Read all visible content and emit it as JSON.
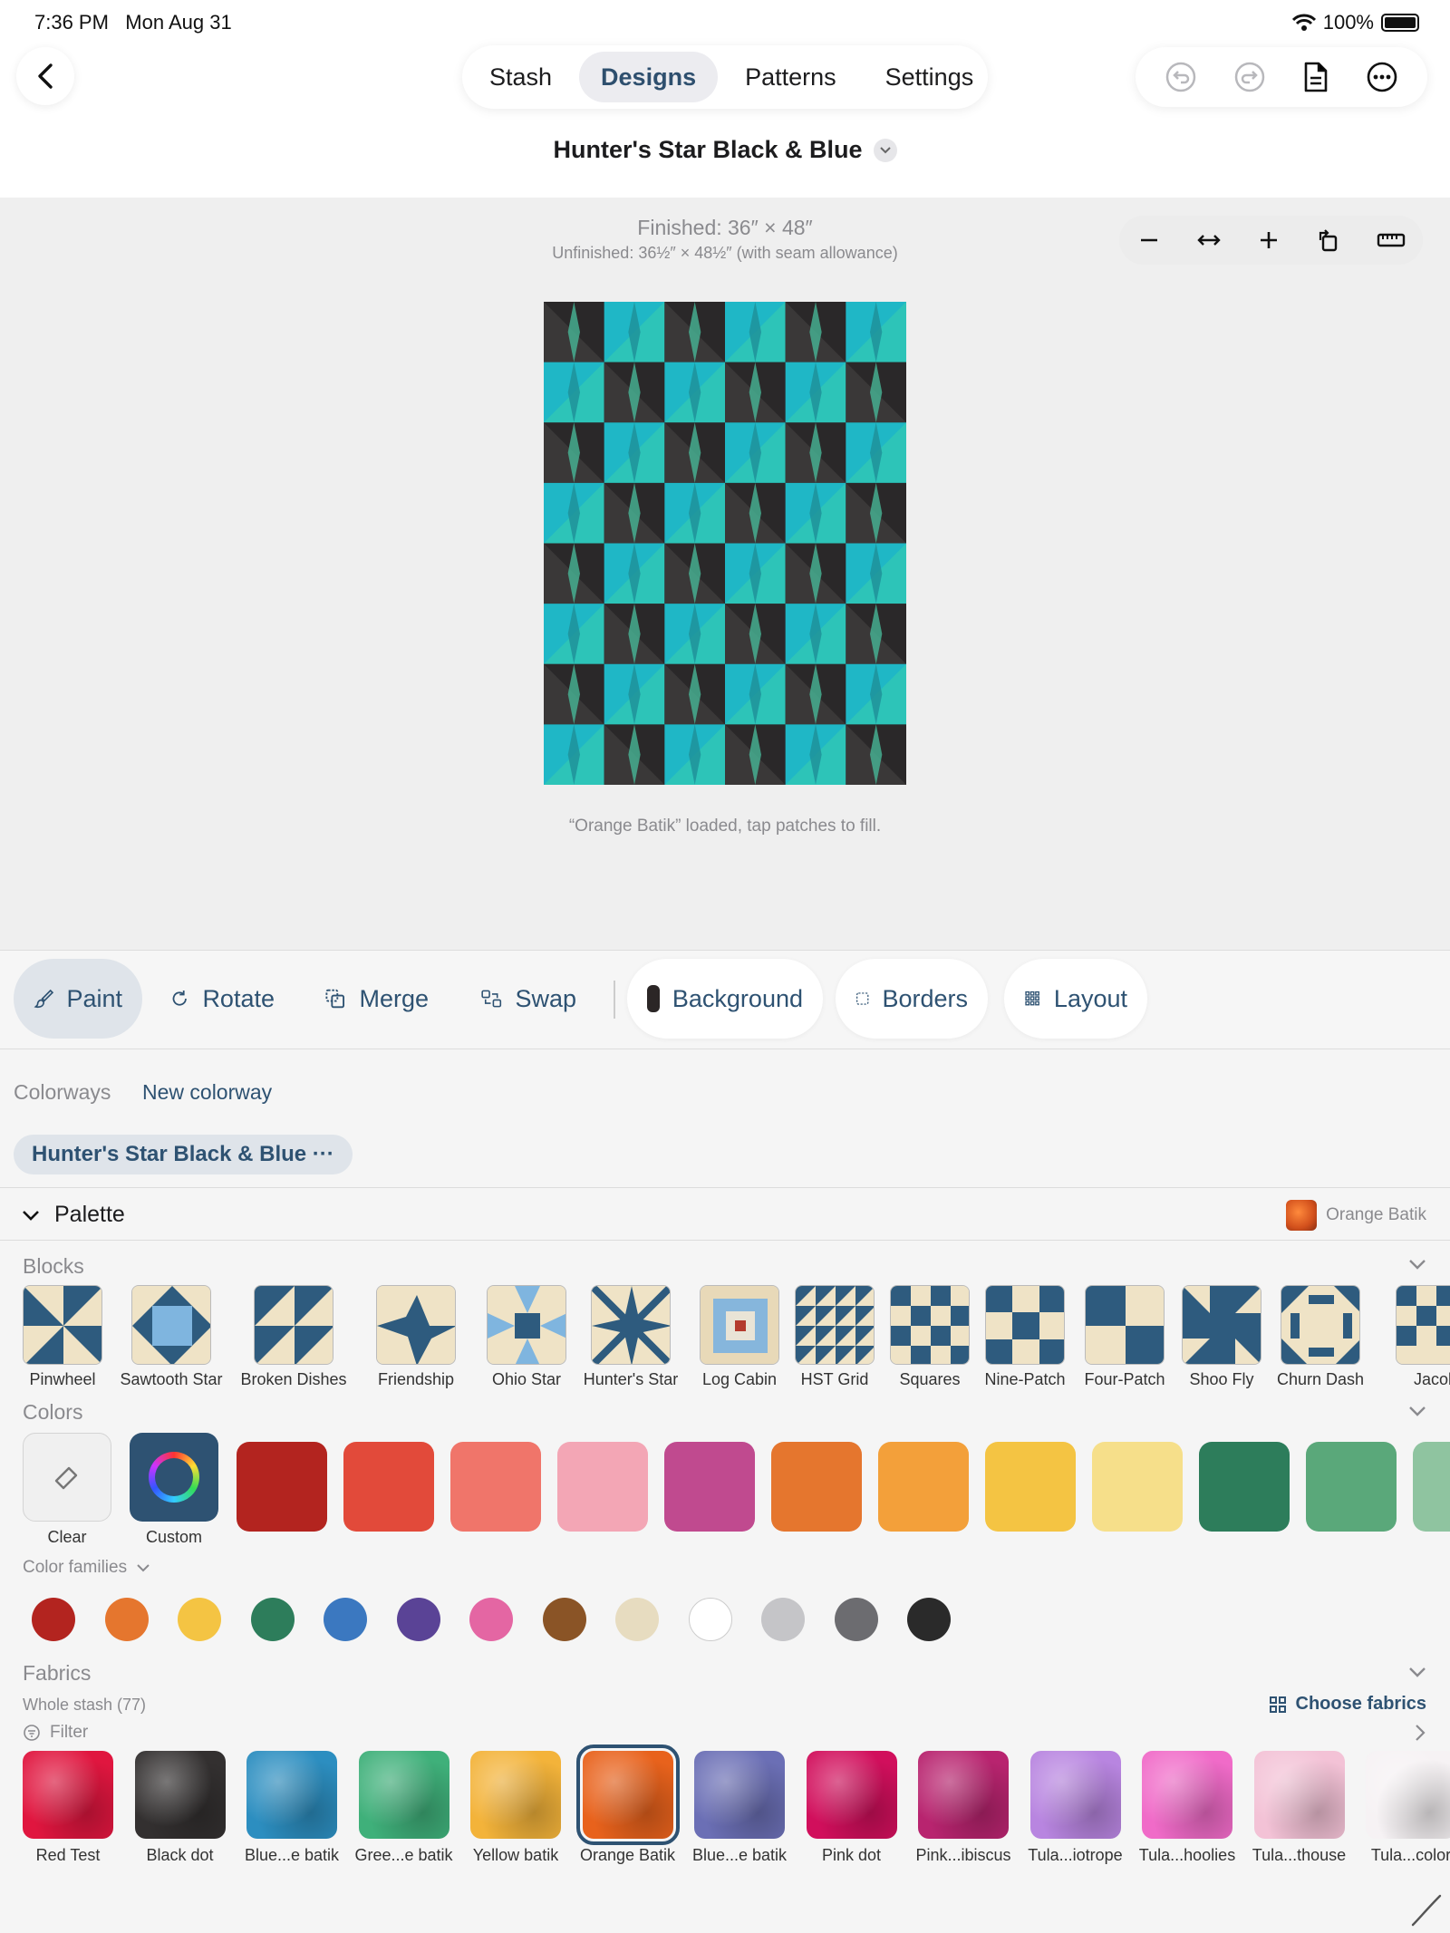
{
  "status_bar": {
    "time": "7:36 PM",
    "date": "Mon Aug 31",
    "battery": "100%"
  },
  "nav": {
    "tabs": [
      {
        "label": "Stash",
        "active": false
      },
      {
        "label": "Designs",
        "active": true
      },
      {
        "label": "Patterns",
        "active": false
      },
      {
        "label": "Settings",
        "active": false
      }
    ],
    "tool_icons": [
      "undo-icon",
      "redo-icon",
      "document-icon",
      "more-icon"
    ]
  },
  "design": {
    "title": "Hunter's Star Black & Blue",
    "finished": "Finished: 36″ × 48″",
    "unfinished": "Unfinished: 36½″ × 48½″ (with seam allowance)",
    "hint": "“Orange Batik” loaded, tap patches to fill."
  },
  "zoom_icons": [
    "zoom-out-icon",
    "fit-width-icon",
    "zoom-in-icon",
    "rotate-icon",
    "ruler-icon"
  ],
  "toolbar": {
    "paint": "Paint",
    "rotate": "Rotate",
    "merge": "Merge",
    "swap": "Swap",
    "background": "Background",
    "borders": "Borders",
    "layout": "Layout"
  },
  "colorways": {
    "label": "Colorways",
    "new": "New colorway",
    "active": "Hunter's Star Black & Blue ···"
  },
  "palette": {
    "title": "Palette",
    "selected": "Orange Batik"
  },
  "blocks": {
    "title": "Blocks",
    "items": [
      "Pinwheel",
      "Sawtooth Star",
      "Broken Dishes",
      "Friendship",
      "Ohio Star",
      "Hunter's Star",
      "Log Cabin",
      "HST Grid",
      "Squares",
      "Nine-Patch",
      "Four-Patch",
      "Shoo Fly",
      "Churn Dash",
      "Jacob"
    ]
  },
  "colors": {
    "title": "Colors",
    "clear": "Clear",
    "custom": "Custom",
    "swatches": [
      "#b3241f",
      "#e24a3a",
      "#f0756a",
      "#f3a6b5",
      "#c04a8f",
      "#e5762e",
      "#f3a03a",
      "#f4c443",
      "#f6df8a",
      "#2d7d5b",
      "#5aa87a",
      "#8fc4a0"
    ]
  },
  "color_families": {
    "label": "Color families",
    "colors": [
      "#b3241f",
      "#e5762e",
      "#f4c443",
      "#2d7d5b",
      "#3b78c0",
      "#5a4396",
      "#e466a3",
      "#8a5426",
      "#e7dcc0",
      "#ffffff",
      "#c5c5c8",
      "#6c6c70",
      "#2a2a2a"
    ]
  },
  "fabrics": {
    "title": "Fabrics",
    "subtitle": "Whole stash (77)",
    "filter": "Filter",
    "choose": "Choose fabrics",
    "items": [
      {
        "label": "Red Test",
        "color": "#e0163f"
      },
      {
        "label": "Black dot",
        "color": "#333030"
      },
      {
        "label": "Blue...e batik",
        "color": "#2c8ec0"
      },
      {
        "label": "Gree...e batik",
        "color": "#3fb07a"
      },
      {
        "label": "Yellow batik",
        "color": "#f3b33a"
      },
      {
        "label": "Orange Batik",
        "color": "#e8621c"
      },
      {
        "label": "Blue...e batik",
        "color": "#6b6fb5"
      },
      {
        "label": "Pink dot",
        "color": "#d10f5c"
      },
      {
        "label": "Pink...ibiscus",
        "color": "#b8246f"
      },
      {
        "label": "Tula...iotrope",
        "color": "#b885e0"
      },
      {
        "label": "Tula...hoolies",
        "color": "#f06bc8"
      },
      {
        "label": "Tula...thouse",
        "color": "#f3c2d6"
      },
      {
        "label": "Tula...color",
        "color": "#f6f2f4"
      }
    ]
  }
}
